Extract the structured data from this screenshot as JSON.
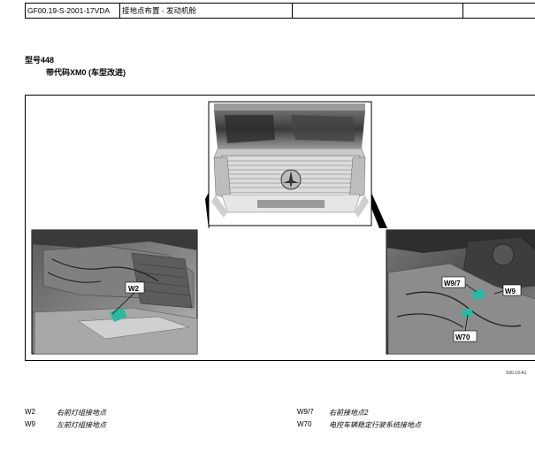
{
  "header": {
    "doc_id": "GF00.19-S-2001-17VDA",
    "title": "接地点布置 - 发动机舱",
    "col3": "",
    "col4": ""
  },
  "model": "型号448",
  "variant": "带代码XM0 (车型改进)",
  "figure": {
    "callouts": {
      "w2": "W2",
      "w9_7": "W9/7",
      "w9": "W9",
      "w70": "W70"
    },
    "code": "S00.19-A1"
  },
  "legend": {
    "left": [
      {
        "code": "W2",
        "desc": "右前灯组接地点"
      },
      {
        "code": "W9",
        "desc": "左前灯组接地点"
      }
    ],
    "right": [
      {
        "code": "W9/7",
        "desc": "右前接地点2"
      },
      {
        "code": "W70",
        "desc": "电控车辆稳定行驶系统接地点"
      }
    ]
  }
}
